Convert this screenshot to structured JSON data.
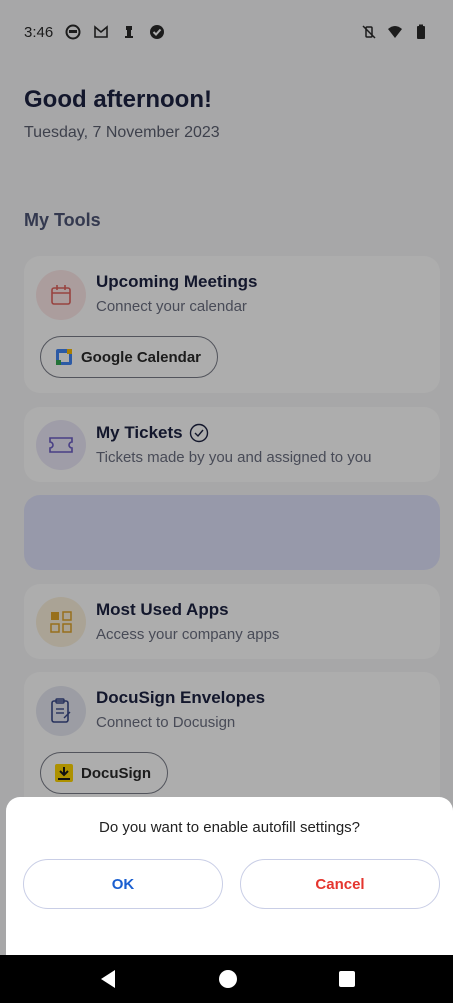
{
  "status_bar": {
    "time": "3:46",
    "left_icons": [
      "app-icon",
      "gmail-icon",
      "chess-icon",
      "check-circle-icon"
    ],
    "right_icons": [
      "vibrate-off-icon",
      "wifi-icon",
      "battery-icon"
    ]
  },
  "header": {
    "greeting": "Good afternoon!",
    "date": "Tuesday, 7 November 2023"
  },
  "tools": {
    "section_title": "My Tools",
    "meetings": {
      "title": "Upcoming Meetings",
      "subtitle": "Connect your calendar",
      "button_label": "Google Calendar",
      "icon_color": "#e0635f"
    },
    "tickets": {
      "title": "My Tickets",
      "subtitle": "Tickets made by you and assigned to you",
      "icon_color": "#6b5cc4"
    },
    "apps": {
      "title": "Most Used Apps",
      "subtitle": "Access your company apps",
      "icon_color": "#e0a52a"
    },
    "docusign": {
      "title": "DocuSign Envelopes",
      "subtitle": "Connect to Docusign",
      "button_label": "DocuSign",
      "icon_color": "#3a4a8a"
    }
  },
  "dialog": {
    "prompt": "Do you want to enable autofill settings?",
    "ok_label": "OK",
    "cancel_label": "Cancel",
    "ok_color": "#1a5fd0",
    "cancel_color": "#e5352e"
  },
  "navigation": {
    "back": "back-icon",
    "home": "home-icon",
    "recents": "recents-icon"
  }
}
